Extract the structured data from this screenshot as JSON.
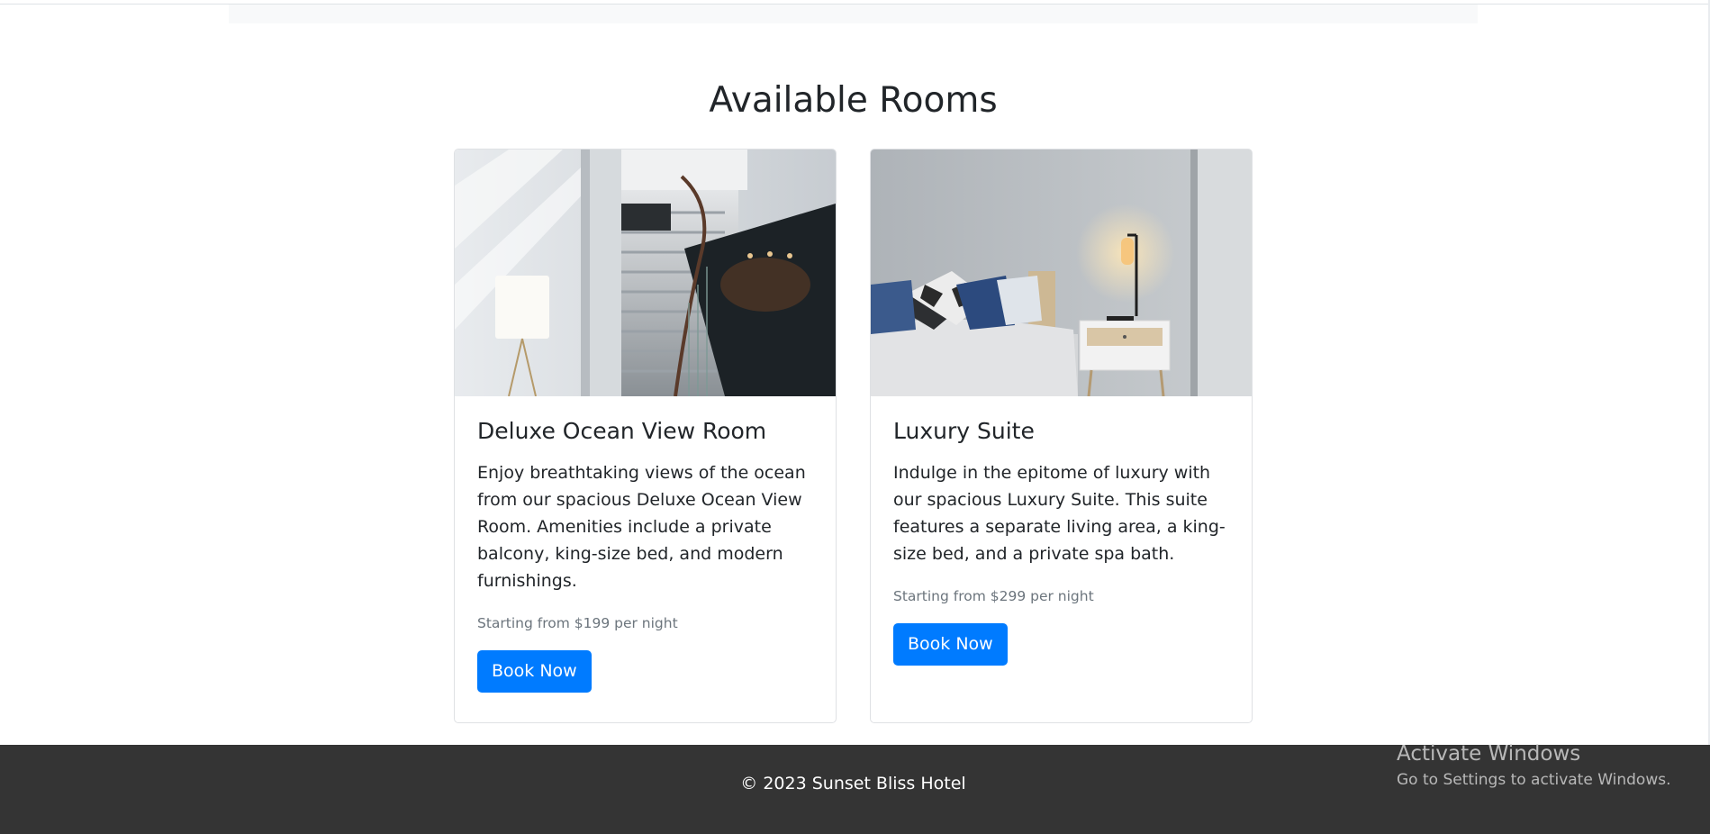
{
  "section": {
    "title": "Available Rooms"
  },
  "rooms": [
    {
      "name": "Deluxe Ocean View Room",
      "description": "Enjoy breathtaking views of the ocean from our spacious Deluxe Ocean View Room. Amenities include a private balcony, king-size bed, and modern furnishings.",
      "price": "Starting from $199 per night",
      "button_label": "Book Now",
      "image_subject": "staircase-photo"
    },
    {
      "name": "Luxury Suite",
      "description": "Indulge in the epitome of luxury with our spacious Luxury Suite. This suite features a separate living area, a king-size bed, and a private spa bath.",
      "price": "Starting from $299 per night",
      "button_label": "Book Now",
      "image_subject": "bedroom-photo"
    }
  ],
  "footer": {
    "copyright": "© 2023 Sunset Bliss Hotel"
  },
  "watermark": {
    "title": "Activate Windows",
    "subtitle": "Go to Settings to activate Windows."
  },
  "colors": {
    "primary_button": "#007bff",
    "footer_bg": "#343434",
    "muted_text": "#6c757d",
    "heading_text": "#212529"
  }
}
